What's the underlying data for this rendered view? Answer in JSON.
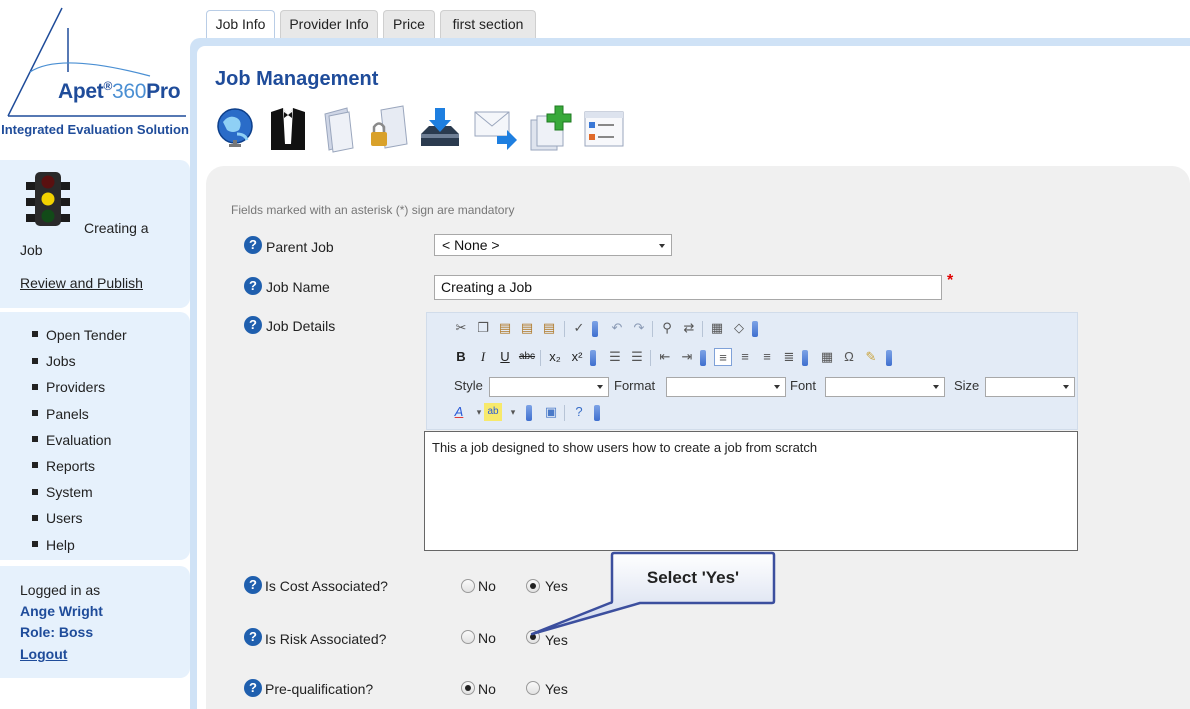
{
  "brand": {
    "name": "Apet",
    "registered": "®",
    "suffix_light": "360",
    "suffix_bold": "Pro",
    "tagline": "Integrated Evaluation Solution",
    "color": "#1f4c9a"
  },
  "sidebar": {
    "task_title_1": "Creating a",
    "task_title_2": "Job",
    "review_link": "Review and Publish",
    "nav": [
      {
        "label": "Open Tender"
      },
      {
        "label": "Jobs"
      },
      {
        "label": "Providers"
      },
      {
        "label": "Panels"
      },
      {
        "label": "Evaluation"
      },
      {
        "label": "Reports"
      },
      {
        "label": "System"
      },
      {
        "label": "Users"
      },
      {
        "label": "Help"
      }
    ]
  },
  "user": {
    "logged_in_label": "Logged in as",
    "name": "Ange Wright",
    "role": "Role: Boss",
    "logout": "Logout"
  },
  "tabs": [
    {
      "label": "Job Info",
      "active": true
    },
    {
      "label": "Provider Info"
    },
    {
      "label": "Price"
    },
    {
      "label": "first section"
    }
  ],
  "page": {
    "title": "Job Management",
    "toolbar_icons": [
      "globe-icon",
      "tuxedo-icon",
      "documents-icon",
      "lock-document-icon",
      "inbox-download-icon",
      "mail-forward-icon",
      "add-document-icon",
      "list-form-icon"
    ]
  },
  "form": {
    "mandatory_note": "Fields marked with an asterisk (*) sign are mandatory",
    "parent_job": {
      "label": "Parent Job",
      "value": "< None >"
    },
    "job_name": {
      "label": "Job Name",
      "value": "Creating a Job",
      "required": "*"
    },
    "job_details": {
      "label": "Job Details",
      "value": "This a job designed to show users how to create a job from scratch",
      "style_label": "Style",
      "format_label": "Format",
      "font_label": "Font",
      "size_label": "Size"
    },
    "cost": {
      "label": "Is Cost Associated?",
      "no": "No",
      "yes": "Yes",
      "selected": "Yes"
    },
    "risk": {
      "label": "Is Risk Associated?",
      "no": "No",
      "yes": "Yes",
      "selected": "Yes"
    },
    "prequal": {
      "label": "Pre-qualification?",
      "no": "No",
      "yes": "Yes",
      "selected": "No"
    }
  },
  "callout": {
    "text": "Select 'Yes'"
  }
}
